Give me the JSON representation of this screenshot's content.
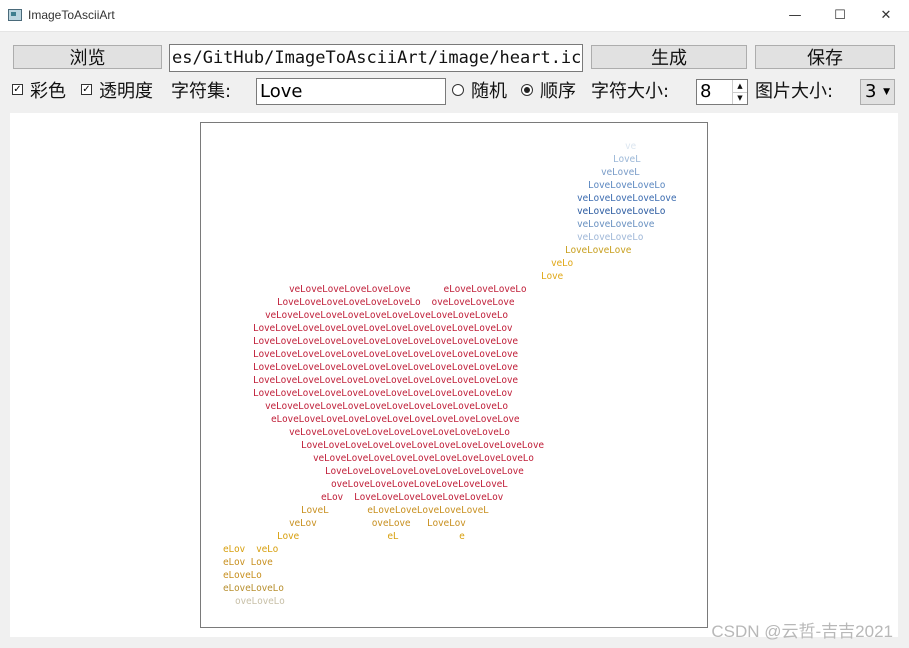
{
  "window": {
    "title": "ImageToAsciiArt",
    "minimize": "—",
    "maximize": "☐",
    "close": "✕"
  },
  "toolbar": {
    "browse_label": "浏览",
    "path_value": "es/GitHub/ImageToAsciiArt/image/heart.ico",
    "generate_label": "生成",
    "save_label": "保存"
  },
  "options": {
    "color_label": "彩色",
    "color_checked": true,
    "alpha_label": "透明度",
    "alpha_checked": true,
    "charset_label": "字符集:",
    "charset_value": "Love",
    "random_label": "随机",
    "sequential_label": "顺序",
    "char_size_label": "字符大小:",
    "char_size_value": "8",
    "image_size_label": "图片大小:",
    "image_size_value": "3"
  },
  "watermark": "CSDN @云哲-吉吉2021",
  "colors": {
    "red": "#c0203a",
    "gold": "#d8a010",
    "blue": "#2a60a0",
    "faint": "#c8c8c8"
  },
  "ascii_art": [
    {
      "text": "ve",
      "color": "#dce6f0"
    },
    {
      "text": "LoveL",
      "color": "#9cb8d8"
    },
    {
      "text": "veLoveL",
      "color": "#7a9cc8"
    },
    {
      "text": "LoveLoveLoveLo",
      "color": "#5c88c0"
    },
    {
      "text": "veLoveLoveLoveLove",
      "color": "#3c6cb0"
    },
    {
      "text": "veLoveLoveLoveLo",
      "color": "#2a5aa0"
    },
    {
      "text": "veLoveLoveLove",
      "color": "#6890c0"
    },
    {
      "text": "veLoveLoveLo",
      "color": "#a0b8d8"
    },
    {
      "text": "LoveLoveLove",
      "color": "#c8a020"
    },
    {
      "text": "veLo",
      "color": "#e0a818"
    },
    {
      "text": "Love",
      "color": "#e0a818"
    },
    {
      "text": "veLoveLoveLoveLoveLove      eLoveLoveLoveLo",
      "color": "#c0203a"
    },
    {
      "text": "LoveLoveLoveLoveLoveLoveLo  oveLoveLoveLove",
      "color": "#c0203a"
    },
    {
      "text": "veLoveLoveLoveLoveLoveLoveLoveLoveLoveLoveLo",
      "color": "#c0203a"
    },
    {
      "text": "LoveLoveLoveLoveLoveLoveLoveLoveLoveLoveLoveLov",
      "color": "#c0203a"
    },
    {
      "text": "LoveLoveLoveLoveLoveLoveLoveLoveLoveLoveLoveLove",
      "color": "#c0203a"
    },
    {
      "text": "LoveLoveLoveLoveLoveLoveLoveLoveLoveLoveLoveLove",
      "color": "#c0203a"
    },
    {
      "text": "LoveLoveLoveLoveLoveLoveLoveLoveLoveLoveLoveLove",
      "color": "#c0203a"
    },
    {
      "text": "LoveLoveLoveLoveLoveLoveLoveLoveLoveLoveLoveLove",
      "color": "#c0203a"
    },
    {
      "text": "LoveLoveLoveLoveLoveLoveLoveLoveLoveLoveLoveLov",
      "color": "#c0203a"
    },
    {
      "text": "veLoveLoveLoveLoveLoveLoveLoveLoveLoveLoveLo",
      "color": "#c0203a"
    },
    {
      "text": "eLoveLoveLoveLoveLoveLoveLoveLoveLoveLoveLove",
      "color": "#c0203a"
    },
    {
      "text": "veLoveLoveLoveLoveLoveLoveLoveLoveLoveLo",
      "color": "#c0203a"
    },
    {
      "text": "LoveLoveLoveLoveLoveLoveLoveLoveLoveLoveLove",
      "color": "#c0203a"
    },
    {
      "text": "veLoveLoveLoveLoveLoveLoveLoveLoveLoveLo",
      "color": "#c0203a"
    },
    {
      "text": "LoveLoveLoveLoveLoveLoveLoveLoveLove",
      "color": "#c0203a"
    },
    {
      "text": "oveLoveLoveLoveLoveLoveLoveLoveL",
      "color": "#c0203a"
    },
    {
      "text": "eLov  LoveLoveLoveLoveLoveLoveLov",
      "color": "#c0203a"
    },
    {
      "text": "LoveL       eLoveLoveLoveLoveLoveL",
      "color": "#c89020"
    },
    {
      "text": "veLov          oveLove   LoveLov",
      "color": "#c89020"
    },
    {
      "text": "Love                eL           e",
      "color": "#d8a010"
    },
    {
      "text": "eLov  veLo",
      "color": "#d8a010"
    },
    {
      "text": "eLov Love",
      "color": "#c89020"
    },
    {
      "text": "eLoveLo",
      "color": "#c89020"
    },
    {
      "text": "eLoveLoveLo",
      "color": "#b89030"
    },
    {
      "text": "oveLoveLo",
      "color": "#c8c0a8"
    }
  ]
}
